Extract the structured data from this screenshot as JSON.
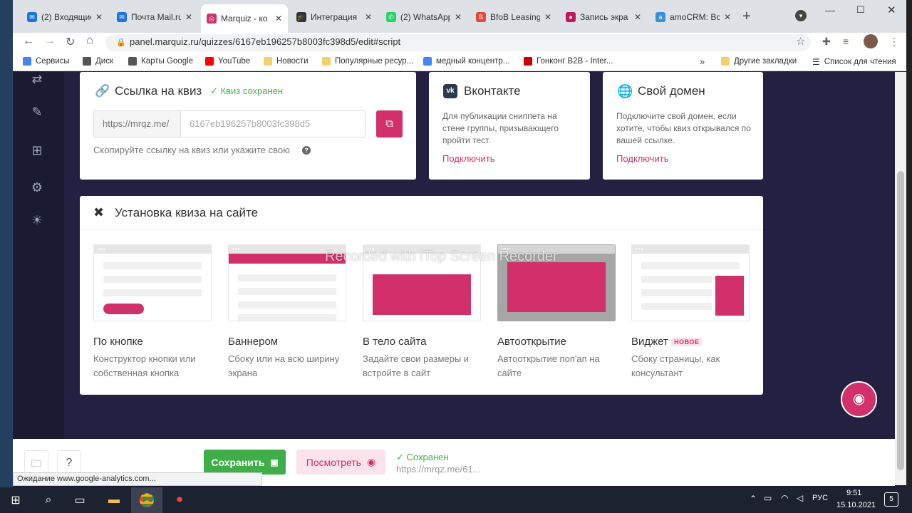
{
  "browser": {
    "tabs": [
      {
        "label": "(2) Входящие",
        "color": "#1a73e8",
        "glyph": "✉"
      },
      {
        "label": "Почта Mail.ru",
        "color": "#1a73e8",
        "glyph": "✉"
      },
      {
        "label": "Marquiz - ко",
        "color": "#d1306b",
        "glyph": "◎"
      },
      {
        "label": "Интеграция",
        "color": "#333333",
        "glyph": "🎓"
      },
      {
        "label": "(2) WhatsApp",
        "color": "#25d366",
        "glyph": "✆"
      },
      {
        "label": "BfoB Leasing",
        "color": "#e8453c",
        "glyph": "B"
      },
      {
        "label": "Запись экра",
        "color": "#c2185b",
        "glyph": "●"
      },
      {
        "label": "amoCRM: Вс",
        "color": "#3a8fd9",
        "glyph": "a"
      }
    ],
    "new_tab": "+",
    "url": "panel.marquiz.ru/quizzes/6167eb196257b8003fc398d5/edit#script",
    "bookmarks": [
      {
        "label": "Сервисы",
        "color": "#4285f4"
      },
      {
        "label": "Диск",
        "color": "#555555"
      },
      {
        "label": "Карты Google",
        "color": "#555555"
      },
      {
        "label": "YouTube",
        "color": "#ff0000"
      },
      {
        "label": "Новости",
        "color": "#f2d16b"
      },
      {
        "label": "Популярные ресур...",
        "color": "#f2d16b"
      },
      {
        "label": "медный концентр...",
        "color": "#4285f4"
      },
      {
        "label": "Гонконг B2B - Inter...",
        "color": "#cc0000"
      }
    ],
    "bookmarks_more": "»",
    "other_bookmarks": "Другие закладки",
    "reading_list": "Список для чтения"
  },
  "link_card": {
    "title": "Ссылка на квиз",
    "saved": "Квиз сохранен",
    "prefix": "https://mrqz.me/",
    "value": "6167eb196257b8003fc398d5",
    "hint": "Скопируйте ссылку на квиз или укажите свою",
    "help": "?"
  },
  "vk_card": {
    "title": "Вконтакте",
    "desc": "Для публикации сниппета на стене группы, призывающего пройти тест.",
    "link": "Подключить"
  },
  "domain_card": {
    "title": "Свой домен",
    "desc": "Подключите свой домен, если хотите, чтобы квиз открывался по вашей ссылке.",
    "link": "Подключить"
  },
  "install": {
    "title": "Установка квиза на сайте",
    "options": [
      {
        "title": "По кнопке",
        "desc": "Конструктор кнопки или собственная кнопка"
      },
      {
        "title": "Баннером",
        "desc": "Сбоку или на всю ширину экрана"
      },
      {
        "title": "В тело сайта",
        "desc": "Задайте свои размеры и встройте в сайт"
      },
      {
        "title": "Автооткрытие",
        "desc": "Автооткрытие поп'ап на сайте"
      },
      {
        "title": "Виджет",
        "badge": "НОВОЕ",
        "desc": "Сбоку страницы, как консультант"
      }
    ]
  },
  "watermark": "Recorded with iTop Screen Recorder",
  "footer": {
    "save": "Сохранить",
    "view": "Посмотреть",
    "status": "Сохранен",
    "status_url": "https://mrqz.me/61...",
    "help": "?",
    "statusbar": "Ожидание www.google-analytics.com..."
  },
  "taskbar": {
    "lang": "РУС",
    "time": "9:51",
    "date": "15.10.2021",
    "notif": "5"
  }
}
